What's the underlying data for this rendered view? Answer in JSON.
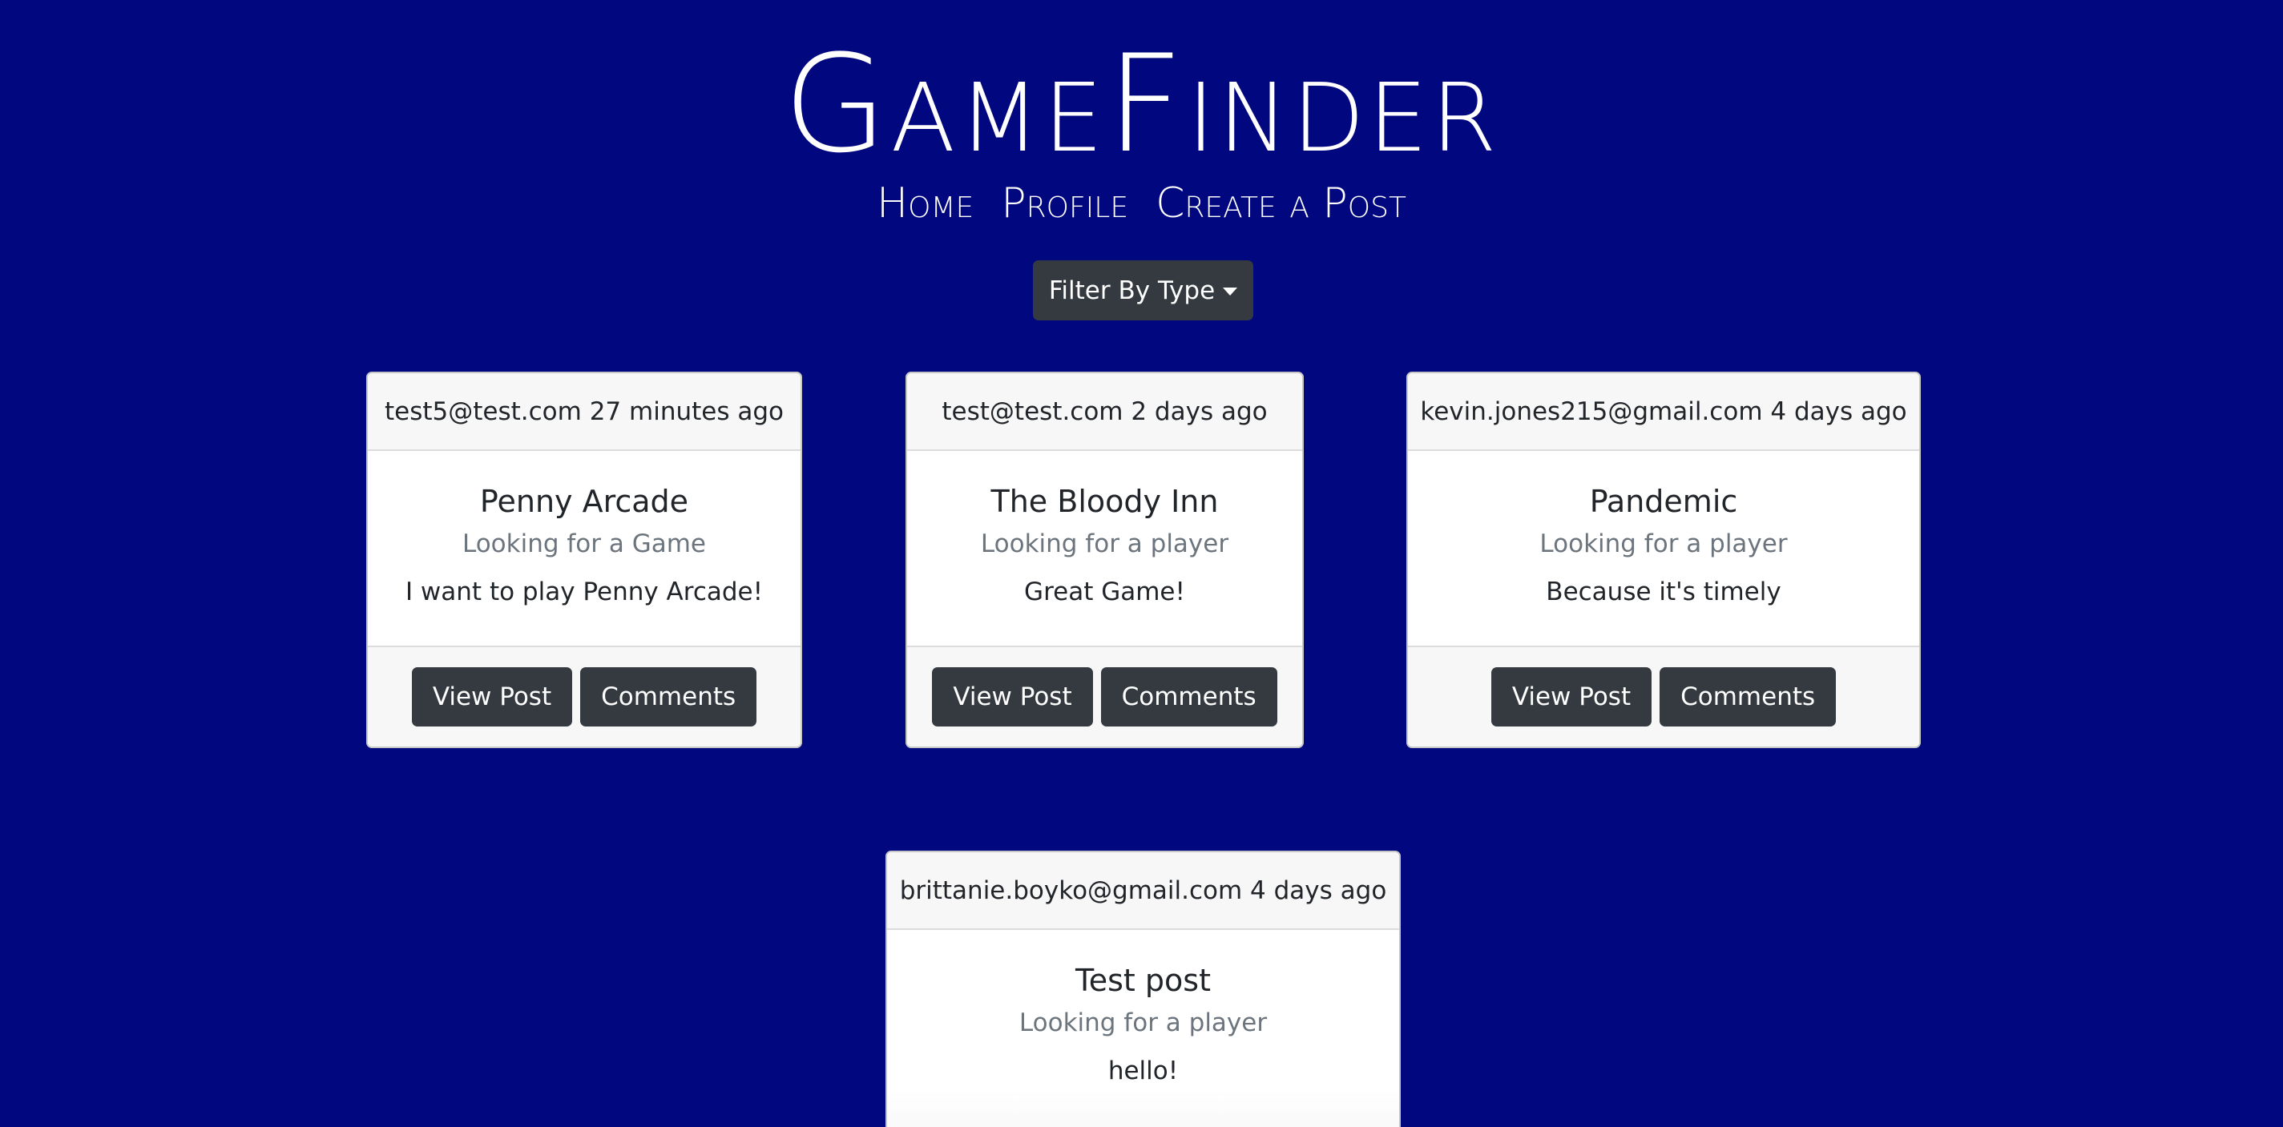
{
  "site": {
    "title": "GameFinder",
    "nav": [
      "Home",
      "Profile",
      "Create a Post"
    ]
  },
  "filter": {
    "label": "Filter By Type"
  },
  "colors": {
    "background": "#01077f",
    "button": "#343a40",
    "card_header": "#f7f7f7",
    "subtitle": "#6c757d"
  },
  "posts": [
    {
      "meta": "test5@test.com 27 minutes ago",
      "title": "Penny Arcade",
      "type": "Looking for a Game",
      "text": "I want to play Penny Arcade!",
      "view_label": "View Post",
      "comments_label": "Comments"
    },
    {
      "meta": "test@test.com 2 days ago",
      "title": "The Bloody Inn",
      "type": "Looking for a player",
      "text": "Great Game!",
      "view_label": "View Post",
      "comments_label": "Comments"
    },
    {
      "meta": "kevin.jones215@gmail.com 4 days ago",
      "title": "Pandemic",
      "type": "Looking for a player",
      "text": "Because it's timely",
      "view_label": "View Post",
      "comments_label": "Comments"
    },
    {
      "meta": "brittanie.boyko@gmail.com 4 days ago",
      "title": "Test post",
      "type": "Looking for a player",
      "text": "hello!"
    }
  ]
}
